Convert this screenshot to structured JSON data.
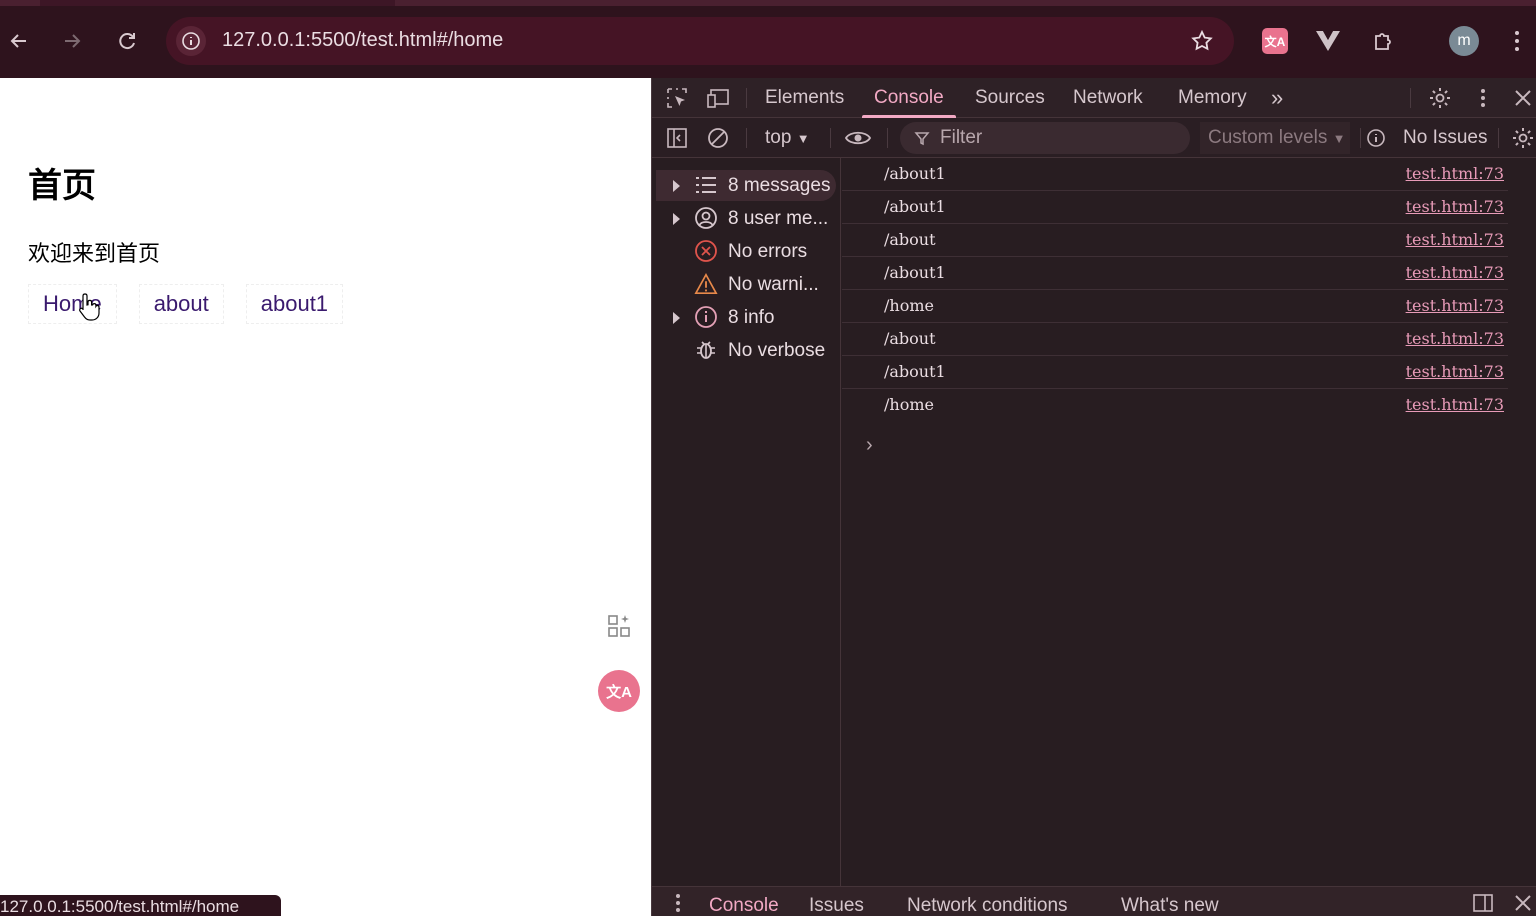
{
  "browser": {
    "url": "127.0.0.1:5500/test.html#/home",
    "avatar_letter": "m",
    "accent": "#2e131d"
  },
  "page": {
    "heading": "首页",
    "welcome": "欢迎来到首页",
    "links": [
      "Home",
      "about",
      "about1"
    ],
    "translate_glyph": "文A",
    "status_url": "127.0.0.1:5500/test.html#/home"
  },
  "devtools": {
    "tabs": [
      "Elements",
      "Console",
      "Sources",
      "Network",
      "Memory"
    ],
    "active_tab": "Console",
    "more_tabs": "»",
    "toolbar": {
      "context": "top",
      "filter_placeholder": "Filter",
      "levels": "Custom levels",
      "issues": "No Issues"
    },
    "sidebar": [
      {
        "label": "8 messages",
        "icon": "list-icon",
        "expandable": true
      },
      {
        "label": "8 user me...",
        "icon": "user-icon",
        "expandable": true
      },
      {
        "label": "No errors",
        "icon": "error-icon",
        "expandable": false
      },
      {
        "label": "No warni...",
        "icon": "warning-icon",
        "expandable": false
      },
      {
        "label": "8 info",
        "icon": "info-icon",
        "expandable": true
      },
      {
        "label": "No verbose",
        "icon": "bug-icon",
        "expandable": false
      }
    ],
    "logs": [
      {
        "msg": "/about1",
        "src": "test.html:73"
      },
      {
        "msg": "/about1",
        "src": "test.html:73"
      },
      {
        "msg": "/about",
        "src": "test.html:73"
      },
      {
        "msg": "/about1",
        "src": "test.html:73"
      },
      {
        "msg": "/home",
        "src": "test.html:73"
      },
      {
        "msg": "/about",
        "src": "test.html:73"
      },
      {
        "msg": "/about1",
        "src": "test.html:73"
      },
      {
        "msg": "/home",
        "src": "test.html:73"
      }
    ],
    "drawer_tabs": [
      "Console",
      "Issues",
      "Network conditions",
      "What's new"
    ]
  },
  "colors": {
    "active_tab": "#f2a9c4",
    "link_source": "#e89bb8",
    "error": "#e0544c",
    "warning": "#e8894a",
    "info": "#e3a0b5"
  }
}
